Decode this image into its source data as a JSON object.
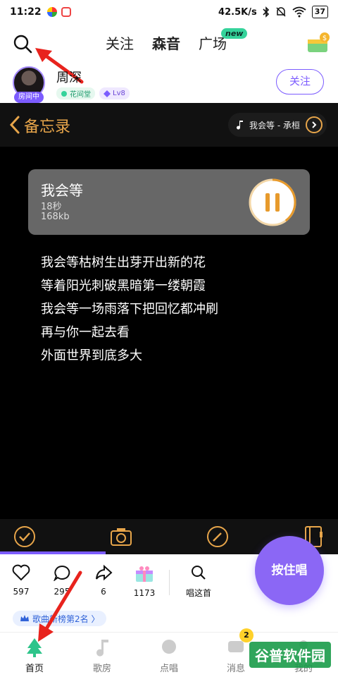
{
  "statusbar": {
    "time": "11:22",
    "net_speed": "42.5K/s",
    "battery": "37"
  },
  "topnav": {
    "tabs": [
      {
        "label": "关注"
      },
      {
        "label": "森音"
      },
      {
        "label": "广场"
      }
    ],
    "new_badge": "new"
  },
  "user": {
    "name": "周深",
    "room_tag": "房间中",
    "badge_1": "花间堂",
    "badge_2": "Lv8",
    "follow_label": "关注"
  },
  "memo": {
    "title": "备忘录",
    "song_chip": "我会等 - 承桓",
    "audio": {
      "title": "我会等",
      "length": "18秒",
      "size": "168kb",
      "playback_progress": 0.4
    },
    "lyrics": [
      "我会等枯树生出芽开出新的花",
      "等着阳光刺破黑暗第一缕朝霞",
      "我会等一场雨落下把回忆都冲刷",
      "再与你一起去看",
      "外面世界到底多大"
    ]
  },
  "interactions": {
    "likes": "597",
    "comments": "295",
    "shares": "6",
    "gifts": "1173",
    "sing_this": "唱这首"
  },
  "sing_button": "按住唱",
  "rank_pill": "歌曲新榜第2名 〉",
  "bottomnav": {
    "items": [
      {
        "label": "首页"
      },
      {
        "label": "歌房"
      },
      {
        "label": "点唱"
      },
      {
        "label": "消息"
      },
      {
        "label": "我的"
      }
    ],
    "message_badge": "2"
  },
  "watermark": "谷普软件园",
  "colors": {
    "accent": "#7c5cff",
    "memo_orange": "#e7a54a",
    "teal": "#35d39b"
  },
  "icons": [
    "search-icon",
    "gift-icon",
    "back-chevron-icon",
    "music-note-icon",
    "play-icon",
    "pause-icon",
    "check-icon",
    "camera-icon",
    "pencil-icon",
    "notebook-icon",
    "heart-icon",
    "comment-icon",
    "share-icon",
    "gift-box-icon",
    "home-tree-icon"
  ]
}
